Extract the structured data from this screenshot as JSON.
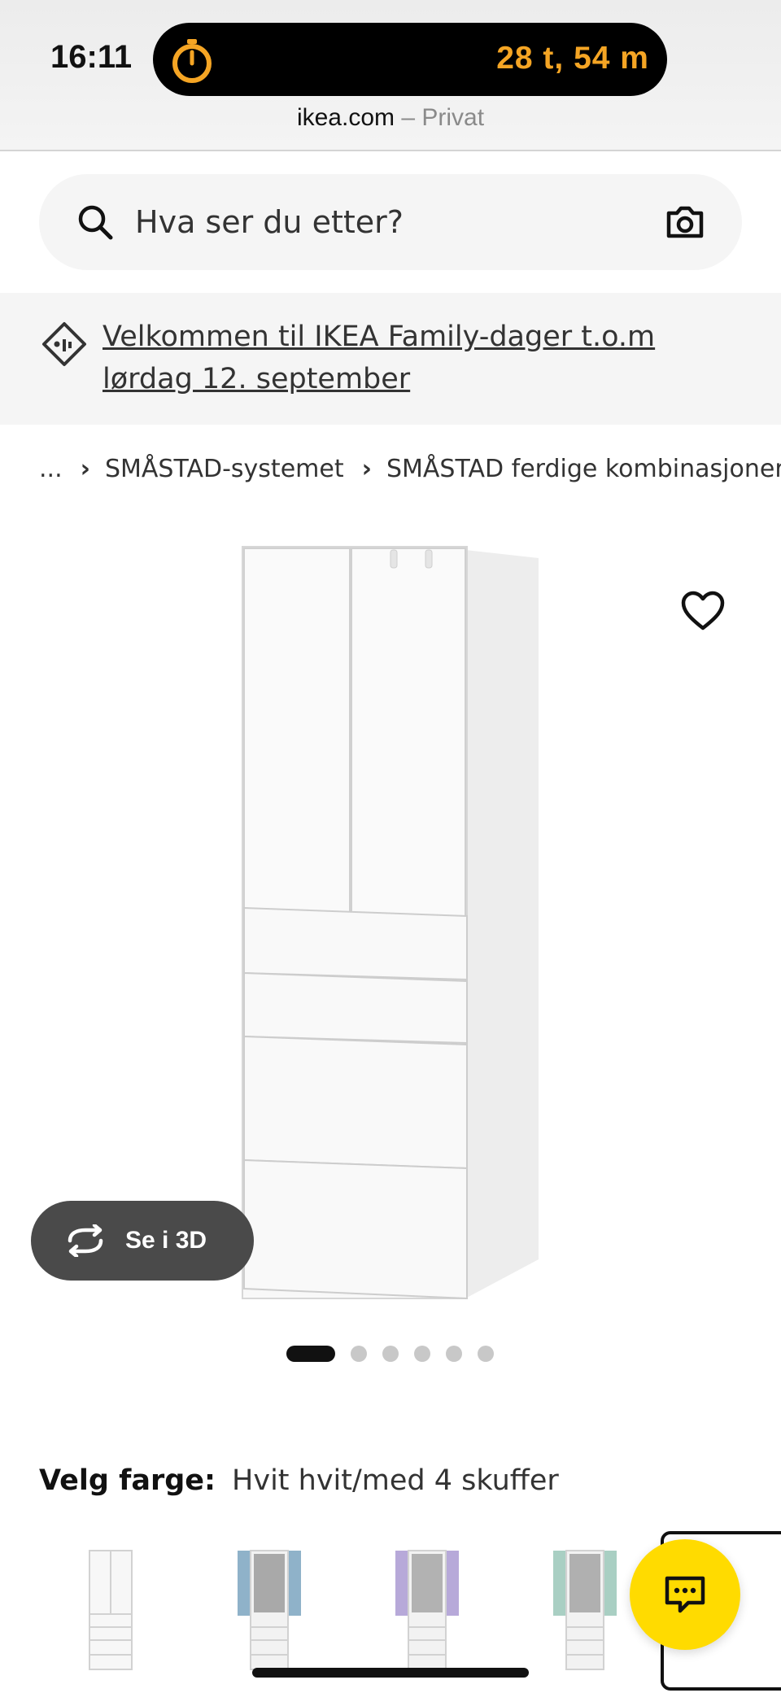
{
  "status_bar": {
    "time": "16:11",
    "timer": "28 t, 54 m",
    "timer_color": "#f5a524"
  },
  "browser": {
    "domain": "ikea.com",
    "mode": " – Privat"
  },
  "search": {
    "placeholder": "Hva ser du etter?",
    "icons": [
      "search-icon",
      "camera-icon"
    ]
  },
  "promo": {
    "text": "Velkommen til IKEA Family-dager t.o.m lørdag 12. september",
    "icon": "tag-icon"
  },
  "breadcrumb": {
    "items": [
      "...",
      "SMÅSTAD-systemet",
      "SMÅSTAD ferdige kombinasjoner"
    ]
  },
  "product": {
    "view_3d_label": "Se i 3D",
    "carousel": {
      "total": 6,
      "active": 1
    }
  },
  "color_picker": {
    "label": "Velg farge:",
    "selected": "Hvit hvit/med 4 skuffer",
    "swatch_colors": [
      "#f2f2f2",
      "#8fb2c9",
      "#b7a9d9",
      "#a9cfc3",
      "#f2f2f2"
    ]
  },
  "chat": {
    "icon": "chat-icon",
    "color": "#ffdb00"
  }
}
